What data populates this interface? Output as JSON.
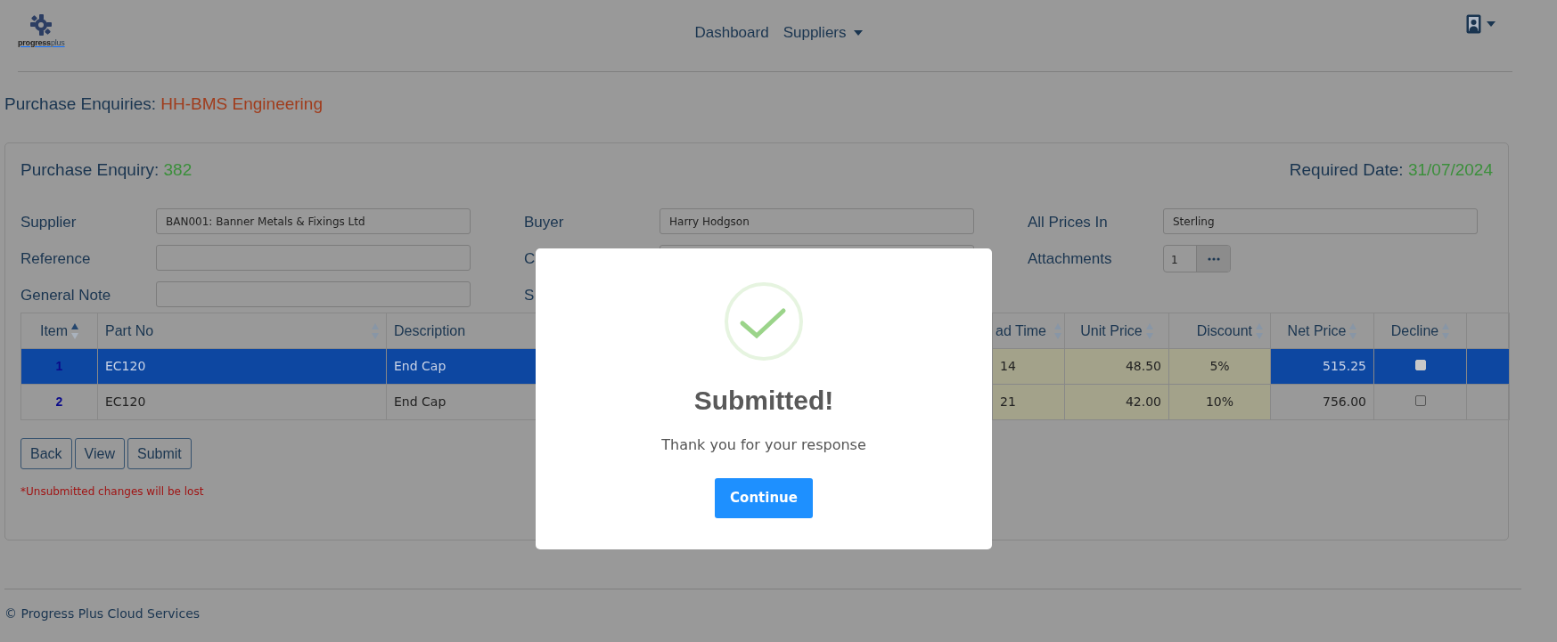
{
  "navbar": {
    "brand": {
      "name": "progress",
      "suffix": "plus"
    },
    "links": [
      {
        "label": "Dashboard",
        "dropdown": false
      },
      {
        "label": "Suppliers",
        "dropdown": true
      }
    ],
    "user_menu": {
      "dropdown": true
    }
  },
  "page_title": {
    "label": "Purchase Enquiries:",
    "value": "HH-BMS Engineering"
  },
  "enquiry": {
    "label": "Purchase Enquiry:",
    "number": "382",
    "required_label": "Required Date:",
    "required_date": "31/07/2024",
    "form_columns": [
      [
        {
          "kind": "text",
          "label": "Supplier",
          "value": "BAN001: Banner Metals & Fixings Ltd"
        },
        {
          "kind": "text",
          "label": "Reference"
        },
        {
          "kind": "text",
          "label": "General Note"
        }
      ],
      [
        {
          "kind": "text",
          "label": "Buyer",
          "value": "Harry Hodgson"
        },
        {
          "kind": "text",
          "label": "C"
        },
        {
          "kind": "label",
          "label": "S"
        }
      ],
      [
        {
          "kind": "text",
          "label": "All Prices In",
          "value": "Sterling"
        },
        {
          "kind": "attachments",
          "label": "Attachments",
          "value": "1"
        }
      ]
    ],
    "table": {
      "columns": [
        {
          "label": "Item",
          "sorted": true
        },
        {
          "label": "Part No",
          "sorted": false
        },
        {
          "label": "Description"
        },
        {
          "label": "ad Time",
          "sorted": false
        },
        {
          "label": "Unit Price",
          "sorted": false
        },
        {
          "label": "Discount",
          "sorted": false
        },
        {
          "label": "Net Price",
          "sorted": false
        },
        {
          "label": "Decline",
          "sorted": false
        }
      ],
      "rows": [
        {
          "item": "1",
          "part_no": "EC120",
          "description": "End Cap",
          "lead_time": "14",
          "unit_price": "48.50",
          "discount": "5%",
          "net_price": "515.25",
          "declined": false,
          "selected": true
        },
        {
          "item": "2",
          "part_no": "EC120",
          "description": "End Cap",
          "lead_time": "21",
          "unit_price": "42.00",
          "discount": "10%",
          "net_price": "756.00",
          "declined": false,
          "selected": false
        }
      ]
    },
    "buttons": [
      "Back",
      "View",
      "Submit"
    ],
    "note": "*Unsubmitted changes will be lost"
  },
  "footer": "© Progress Plus Cloud Services",
  "dialog": {
    "title": "Submitted!",
    "message": "Thank you for your response",
    "button": "Continue"
  }
}
